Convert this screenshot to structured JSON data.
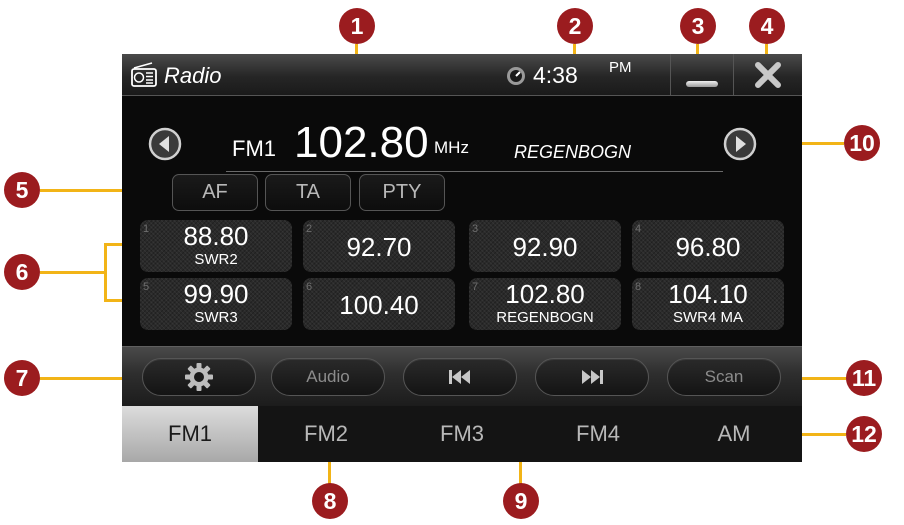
{
  "titlebar": {
    "app_icon": "radio-icon",
    "app_title": "Radio",
    "clock_icon": "clock-icon",
    "time": "4:38",
    "ampm": "PM",
    "minimize_icon": "minimize-icon",
    "close_icon": "close-icon"
  },
  "tuner": {
    "band": "FM1",
    "frequency": "102.80",
    "unit": "MHz",
    "station": "REGENBOGN",
    "prev_icon": "arrow-left-icon",
    "next_icon": "arrow-right-icon"
  },
  "rds": {
    "af": "AF",
    "ta": "TA",
    "pty": "PTY"
  },
  "presets": [
    {
      "num": "1",
      "freq": "88.80",
      "name": "SWR2"
    },
    {
      "num": "2",
      "freq": "92.70",
      "name": ""
    },
    {
      "num": "3",
      "freq": "92.90",
      "name": ""
    },
    {
      "num": "4",
      "freq": "96.80",
      "name": ""
    },
    {
      "num": "5",
      "freq": "99.90",
      "name": "SWR3"
    },
    {
      "num": "6",
      "freq": "100.40",
      "name": ""
    },
    {
      "num": "7",
      "freq": "102.80",
      "name": "REGENBOGN"
    },
    {
      "num": "8",
      "freq": "104.10",
      "name": "SWR4 MA"
    }
  ],
  "controls": {
    "settings_icon": "gear-icon",
    "audio": "Audio",
    "prev_icon": "skip-previous-icon",
    "next_icon": "skip-next-icon",
    "scan": "Scan"
  },
  "bands": [
    "FM1",
    "FM2",
    "FM3",
    "FM4",
    "AM"
  ],
  "active_band": "FM1",
  "callouts": [
    "1",
    "2",
    "3",
    "4",
    "5",
    "6",
    "7",
    "8",
    "9",
    "10",
    "11",
    "12"
  ],
  "colors": {
    "callout": "#9b1c1f",
    "leader": "#f2b417",
    "screen_bg": "#0a0a0a"
  }
}
